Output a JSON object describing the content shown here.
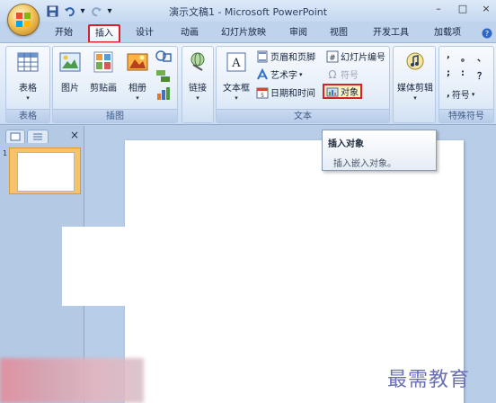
{
  "window": {
    "title": "演示文稿1 - Microsoft PowerPoint",
    "minimize": "–",
    "maximize": "□",
    "close": "×"
  },
  "quick_access": {
    "dropdown": "▾"
  },
  "tabs": [
    {
      "label": "开始"
    },
    {
      "label": "插入",
      "active": true
    },
    {
      "label": "设计"
    },
    {
      "label": "动画"
    },
    {
      "label": "幻灯片放映"
    },
    {
      "label": "审阅"
    },
    {
      "label": "视图"
    },
    {
      "label": "开发工具"
    },
    {
      "label": "加载项"
    }
  ],
  "ribbon": {
    "groups": {
      "table": {
        "label": "表格",
        "buttons": {
          "table": "表格"
        }
      },
      "illustrations": {
        "label": "插图",
        "buttons": {
          "picture": "图片",
          "clipart": "剪贴画",
          "album": "相册"
        }
      },
      "links": {
        "label": "",
        "buttons": {
          "link": "链接"
        }
      },
      "text": {
        "label": "文本",
        "buttons": {
          "textbox": "文本框",
          "header_footer": "页眉和页脚",
          "wordart": "艺术字",
          "datetime": "日期和时间",
          "slide_number": "幻灯片编号",
          "symbol": "符号",
          "object": "对象"
        }
      },
      "media": {
        "label": "",
        "buttons": {
          "media_clip": "媒体剪辑"
        }
      },
      "special": {
        "label": "特殊符号",
        "buttons": {
          "symbol": "符号"
        },
        "marks": [
          ",",
          "。",
          "、",
          ";",
          ":",
          "？"
        ]
      }
    }
  },
  "tooltip": {
    "title": "插入对象",
    "body": "插入嵌入对象。"
  },
  "slides_panel": {
    "close": "×",
    "slide_number": "1"
  },
  "watermark": "最需教育",
  "colors": {
    "accent_red": "#d6222d",
    "ribbon_bg": "#d9e6f6",
    "slide_thumb": "#f6c26a"
  }
}
